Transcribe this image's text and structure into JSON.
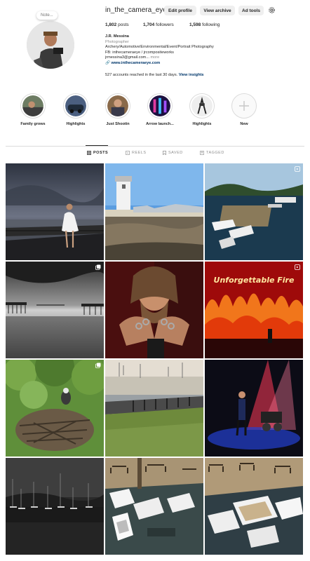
{
  "profile": {
    "username": "in_the_camera_eye",
    "note": "Note...",
    "buttons": {
      "edit": "Edit profile",
      "archive": "View archive",
      "ads": "Ad tools"
    },
    "stats": {
      "posts_count": "1,802",
      "posts_label": "posts",
      "followers_count": "1,704",
      "followers_label": "followers",
      "following_count": "1,598",
      "following_label": "following"
    },
    "bio": {
      "name": "J.R. Messina",
      "category": "Photographer",
      "line1": "Archery/Automotive/Environmental/Event/Portrait Photography",
      "line2": "FB: inthecameraeye / jrcompositeworks",
      "line3": "jrmessina3@gmail.com...",
      "more": "more",
      "link": "www.inthecameraeye.com"
    },
    "insights_text": "527 accounts reached in the last 30 days.",
    "insights_link": "View insights"
  },
  "highlights": [
    {
      "label": "Family grows",
      "color": "#5a6b55"
    },
    {
      "label": "Highlights",
      "color": "#3b4f6e"
    },
    {
      "label": "Just Shootin",
      "color": "#7a5a3a"
    },
    {
      "label": "Arrow launch...",
      "color": "#3c2a6b"
    },
    {
      "label": "Highlights",
      "color": "#9a9a9a"
    },
    {
      "label": "New",
      "color": "#fafafa"
    }
  ],
  "tabs": {
    "posts": "POSTS",
    "reels": "REELS",
    "saved": "SAVED",
    "tagged": "TAGGED"
  },
  "posts": [
    {
      "subject": "woman in white dress on pier under storm clouds",
      "icon": ""
    },
    {
      "subject": "lighthouse and marina with rocky shore",
      "icon": ""
    },
    {
      "subject": "boats moored at harbor dock",
      "icon": "reel-icon"
    },
    {
      "subject": "black and white pier under cloudy sky",
      "icon": "carousel-icon"
    },
    {
      "subject": "bearded man with rings on hands",
      "icon": ""
    },
    {
      "subject": "Unforgettable Fire band on stage",
      "icon": "reel-icon",
      "stage_text": "Unforgettable Fire"
    },
    {
      "subject": "osprey nest in tree",
      "icon": "carousel-icon"
    },
    {
      "subject": "waterfront lawn and railing",
      "icon": ""
    },
    {
      "subject": "guitarist on stage red lights",
      "icon": ""
    },
    {
      "subject": "dark marina under storm sky",
      "icon": ""
    },
    {
      "subject": "white dinghies at dock",
      "icon": ""
    },
    {
      "subject": "rowboats on wooden dock",
      "icon": ""
    }
  ],
  "colors": {
    "link": "#00376b",
    "border": "#dbdbdb",
    "button_bg": "#efefef"
  }
}
